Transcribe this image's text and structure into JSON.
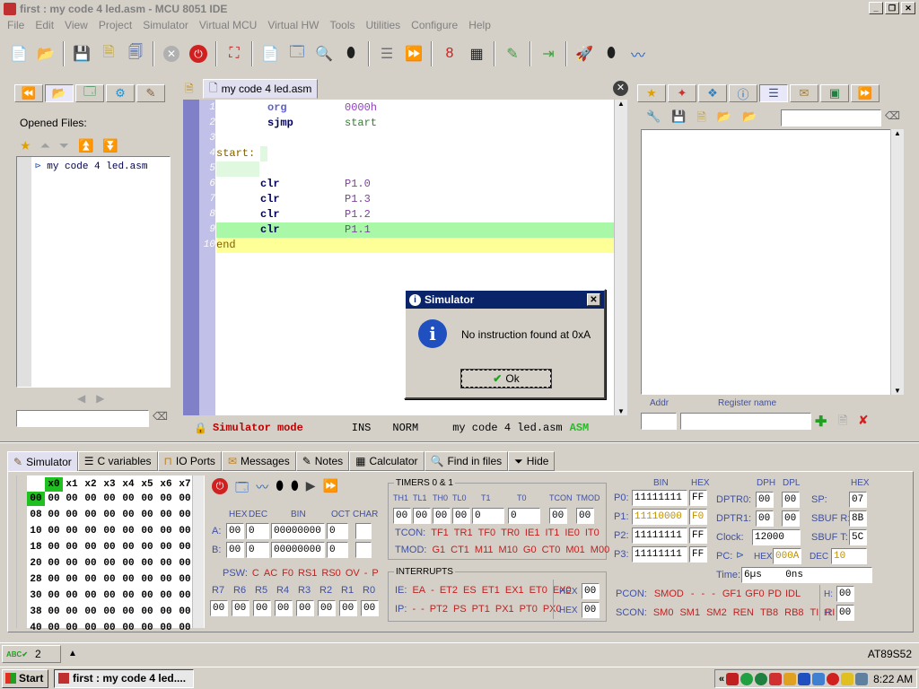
{
  "window": {
    "title": "first : my code 4 led.asm - MCU 8051 IDE"
  },
  "menu": [
    "File",
    "Edit",
    "View",
    "Project",
    "Simulator",
    "Virtual MCU",
    "Virtual HW",
    "Tools",
    "Utilities",
    "Configure",
    "Help"
  ],
  "left_panel": {
    "title": "Opened Files:",
    "files": [
      "my code 4 led.asm"
    ]
  },
  "editor": {
    "tab": "my code 4 led.asm",
    "lines": [
      {
        "n": "1",
        "a": "org",
        "b": "0000h"
      },
      {
        "n": "2",
        "a": "sjmp",
        "b": "start"
      },
      {
        "n": "3",
        "a": "",
        "b": ""
      },
      {
        "n": "4",
        "label": "start:"
      },
      {
        "n": "5",
        "a": "",
        "b": ""
      },
      {
        "n": "6",
        "a": "clr",
        "b": "P1.0"
      },
      {
        "n": "7",
        "a": "clr",
        "b": "P1.3"
      },
      {
        "n": "8",
        "a": "clr",
        "b": "P1.2"
      },
      {
        "n": "9",
        "a": "clr",
        "b": "P1.1"
      },
      {
        "n": "10",
        "label": "end"
      }
    ],
    "status": {
      "mode": "Simulator mode",
      "ins": "INS",
      "norm": "NORM",
      "file": "my code 4 led.asm",
      "lang": "ASM"
    }
  },
  "dialog": {
    "title": "Simulator",
    "message": "No instruction found at 0xA",
    "ok": "Ok"
  },
  "right_panel": {
    "addr_label": "Addr",
    "regname_label": "Register name"
  },
  "bottom_tabs": [
    "Simulator",
    "C variables",
    "IO Ports",
    "Messages",
    "Notes",
    "Calculator",
    "Find in files",
    "Hide"
  ],
  "memory": {
    "cols": [
      "x0",
      "x1",
      "x2",
      "x3",
      "x4",
      "x5",
      "x6",
      "x7"
    ],
    "rows": [
      "00",
      "08",
      "10",
      "18",
      "20",
      "28",
      "30",
      "38",
      "40"
    ],
    "value": "00"
  },
  "regs": {
    "hdr": {
      "hex": "HEX",
      "dec": "DEC",
      "bin": "BIN",
      "oct": "OCT",
      "char": "CHAR"
    },
    "A": {
      "label": "A:",
      "hex": "00",
      "dec": "0",
      "bin": "00000000",
      "oct": "0"
    },
    "B": {
      "label": "B:",
      "hex": "00",
      "dec": "0",
      "bin": "00000000",
      "oct": "0"
    },
    "psw": [
      "PSW:",
      "C",
      "AC",
      "F0",
      "RS1",
      "RS0",
      "OV",
      "-",
      "P"
    ],
    "rnames": [
      "R7",
      "R6",
      "R5",
      "R4",
      "R3",
      "R2",
      "R1",
      "R0"
    ],
    "rvals": [
      "00",
      "00",
      "00",
      "00",
      "00",
      "00",
      "00",
      "00"
    ]
  },
  "timers": {
    "title": "TIMERS 0 & 1",
    "hdr": [
      "TH1",
      "TL1",
      "TH0",
      "TL0",
      "T1",
      "T0",
      "TCON",
      "TMOD"
    ],
    "vals": [
      "00",
      "00",
      "00",
      "00",
      "0",
      "0",
      "00",
      "00"
    ],
    "tcon": [
      "TCON:",
      "TF1",
      "TR1",
      "TF0",
      "TR0",
      "IE1",
      "IT1",
      "IE0",
      "IT0"
    ],
    "tmod": [
      "TMOD:",
      "G1",
      "CT1",
      "M11",
      "M10",
      "G0",
      "CT0",
      "M01",
      "M00"
    ]
  },
  "interrupts": {
    "title": "INTERRUPTS",
    "ie": [
      "IE:",
      "EA",
      "-",
      "ET2",
      "ES",
      "ET1",
      "EX1",
      "ET0",
      "EX0"
    ],
    "ip": [
      "IP:",
      "-",
      "-",
      "PT2",
      "PS",
      "PT1",
      "PX1",
      "PT0",
      "PX0"
    ],
    "hex": "HEX",
    "ie_val": "00",
    "ip_val": "00"
  },
  "ports": {
    "bin": "BIN",
    "hexh": "HEX",
    "rows": [
      {
        "label": "P0:",
        "bin": "11111111",
        "hex": "FF"
      },
      {
        "label": "P1:",
        "bin": "11110000",
        "hex": "F0"
      },
      {
        "label": "P2:",
        "bin": "11111111",
        "hex": "FF"
      },
      {
        "label": "P3:",
        "bin": "11111111",
        "hex": "FF"
      }
    ]
  },
  "dptr": {
    "dph": "DPH",
    "dpl": "DPL",
    "r0": {
      "label": "DPTR0:",
      "h": "00",
      "l": "00"
    },
    "r1": {
      "label": "DPTR1:",
      "h": "00",
      "l": "00"
    },
    "clock_label": "Clock:",
    "clock": "12000",
    "pc_label": "PC:",
    "pc_hex_label": "HEX",
    "pc_hex": "000A",
    "pc_dec_label": "DEC",
    "pc_dec": "10",
    "time_label": "Time:",
    "time": "6µs    0ns"
  },
  "sfr": {
    "hexh": "HEX",
    "sp_label": "SP:",
    "sp": "07",
    "sbufr_label": "SBUF R:",
    "sbufr": "8B",
    "sbuft_label": "SBUF T:",
    "sbuft": "5C"
  },
  "pcon": {
    "label": "PCON:",
    "bits": [
      "SMOD",
      "-",
      "-",
      "-",
      "GF1",
      "GF0",
      "PD",
      "IDL"
    ],
    "h": "H:",
    "val": "00"
  },
  "scon": {
    "label": "SCON:",
    "bits": [
      "SM0",
      "SM1",
      "SM2",
      "REN",
      "TB8",
      "RB8",
      "TI",
      "RI"
    ],
    "h": "H:",
    "val": "00"
  },
  "statusbar": {
    "count": "2",
    "mcu": "AT89S52"
  },
  "taskbar": {
    "start": "Start",
    "item": "first : my code 4 led....",
    "clock": "8:22 AM"
  }
}
